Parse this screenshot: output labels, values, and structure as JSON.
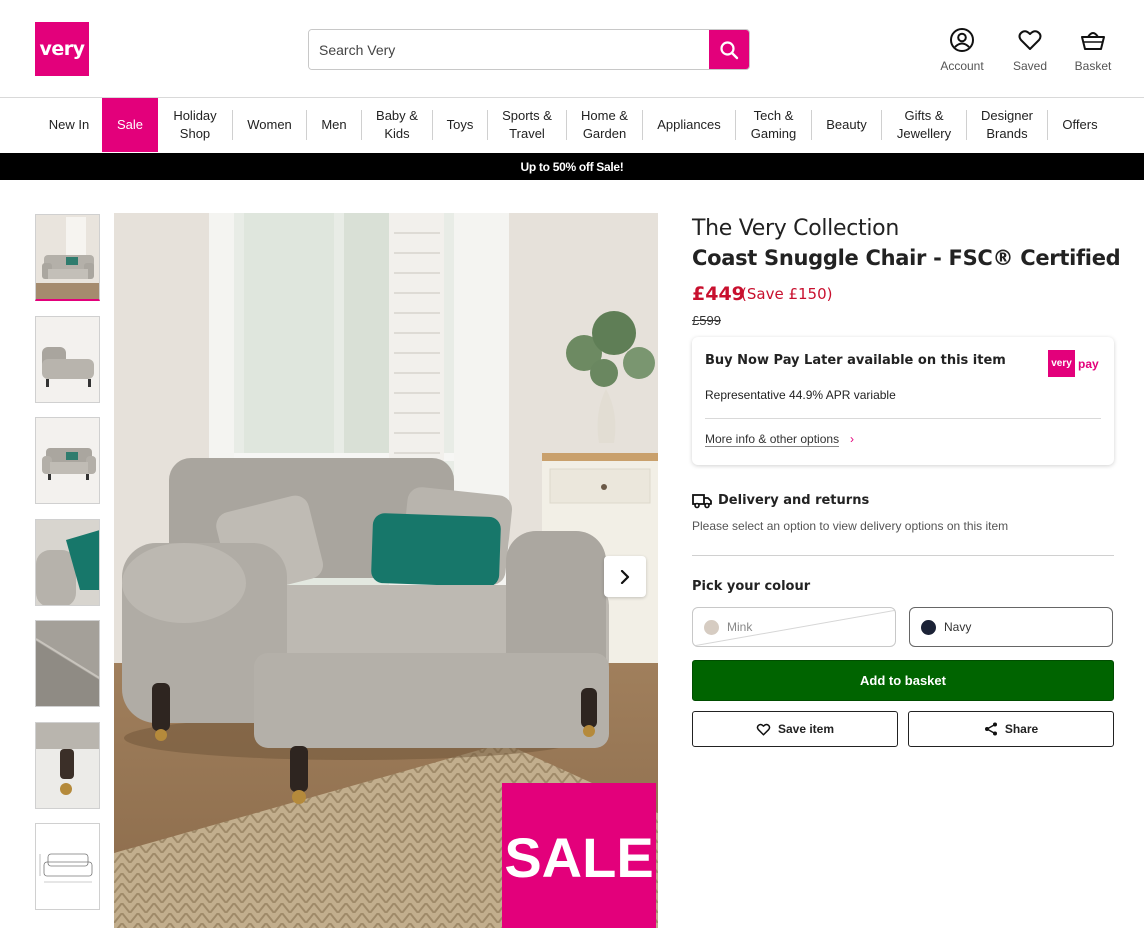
{
  "header": {
    "logo": "very",
    "search": {
      "placeholder": "Search Very",
      "value": ""
    },
    "icons": {
      "account": "Account",
      "saved": "Saved",
      "basket": "Basket"
    }
  },
  "nav": {
    "items": [
      {
        "label": "New In"
      },
      {
        "label": "Sale",
        "active": true
      },
      {
        "label": "Holiday\nShop"
      },
      {
        "label": "Women"
      },
      {
        "label": "Men"
      },
      {
        "label": "Baby &\nKids"
      },
      {
        "label": "Toys"
      },
      {
        "label": "Sports &\nTravel"
      },
      {
        "label": "Home &\nGarden"
      },
      {
        "label": "Appliances"
      },
      {
        "label": "Tech &\nGaming"
      },
      {
        "label": "Beauty"
      },
      {
        "label": "Gifts &\nJewellery"
      },
      {
        "label": "Designer\nBrands"
      },
      {
        "label": "Offers"
      }
    ]
  },
  "banner": "Up to 50% off Sale!",
  "gallery": {
    "thumbnail_count": 7,
    "active_index": 0,
    "sale_badge": "SALE"
  },
  "product": {
    "brand": "The Very Collection",
    "title": "Coast Snuggle Chair - FSC® Certified",
    "price": "£449",
    "saving": "(Save £150)",
    "was_price": "£599"
  },
  "bnpl": {
    "title": "Buy Now Pay Later available on this item",
    "apr": "Representative 44.9% APR variable",
    "link": "More info & other options",
    "logo_box": "very",
    "logo_text": "pay"
  },
  "delivery": {
    "title": "Delivery and returns",
    "subtitle": "Please select an option to view delivery options on this item"
  },
  "colour": {
    "heading": "Pick your colour",
    "options": [
      {
        "label": "Mink",
        "color": "#d6ccc2",
        "available": false
      },
      {
        "label": "Navy",
        "color": "#1b2236",
        "available": true
      }
    ]
  },
  "actions": {
    "add_to_basket": "Add to basket",
    "save_item": "Save item",
    "share": "Share"
  },
  "colors": {
    "brand_pink": "#e3007b",
    "price_red": "#c8102e",
    "basket_green": "#006400"
  }
}
